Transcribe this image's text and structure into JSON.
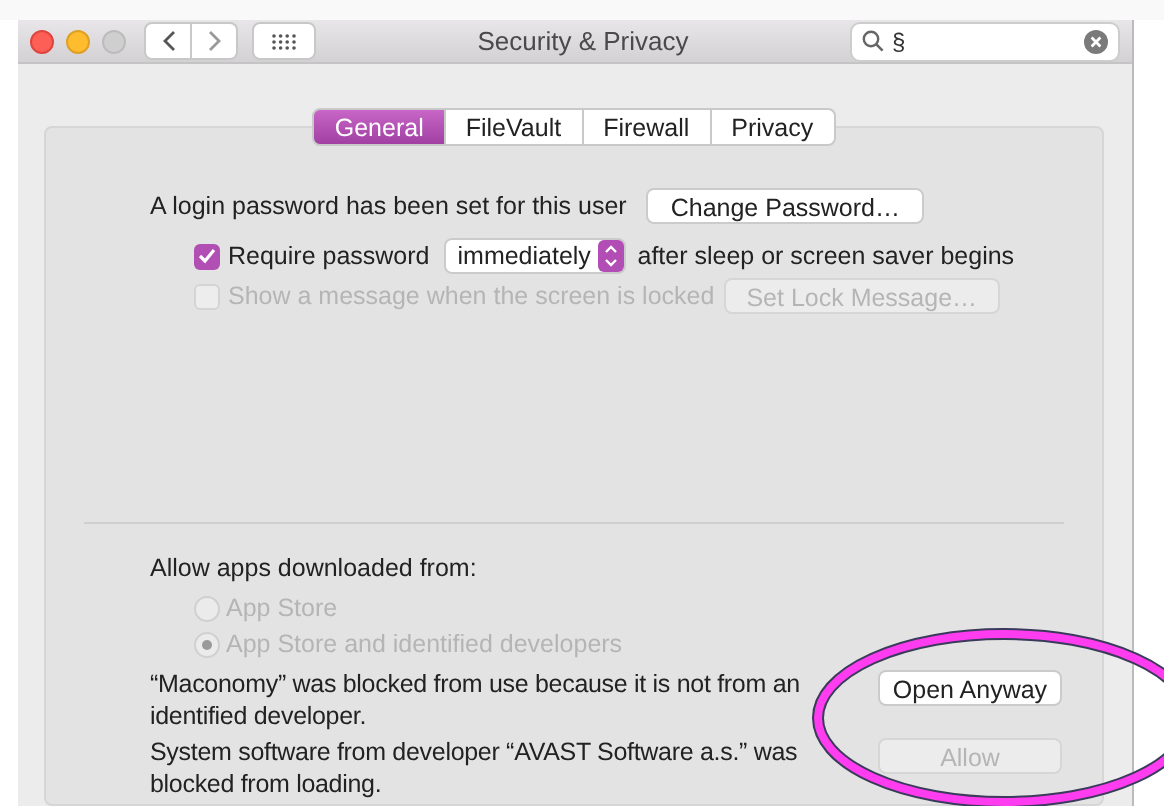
{
  "window": {
    "title": "Security & Privacy"
  },
  "search": {
    "value": "§"
  },
  "tabs": [
    {
      "label": "General",
      "selected": true
    },
    {
      "label": "FileVault",
      "selected": false
    },
    {
      "label": "Firewall",
      "selected": false
    },
    {
      "label": "Privacy",
      "selected": false
    }
  ],
  "general": {
    "login_text": "A login password has been set for this user",
    "change_password_button": "Change Password…",
    "require_password": {
      "checked": true,
      "label": "Require password",
      "delay": "immediately",
      "suffix": "after sleep or screen saver begins"
    },
    "lock_message": {
      "checked": false,
      "disabled": true,
      "label": "Show a message when the screen is locked",
      "button": "Set Lock Message…"
    },
    "allow_apps_label": "Allow apps downloaded from:",
    "sources": [
      {
        "label": "App Store",
        "selected": false,
        "disabled": true
      },
      {
        "label": "App Store and identified developers",
        "selected": true,
        "disabled": true
      }
    ],
    "blocked": [
      {
        "message": "“Maconomy” was blocked from use because it is not from an identified developer.",
        "button": "Open Anyway",
        "disabled": false
      },
      {
        "message": "System software from developer “AVAST Software a.s.” was blocked from loading.",
        "button": "Allow",
        "disabled": true
      }
    ]
  }
}
